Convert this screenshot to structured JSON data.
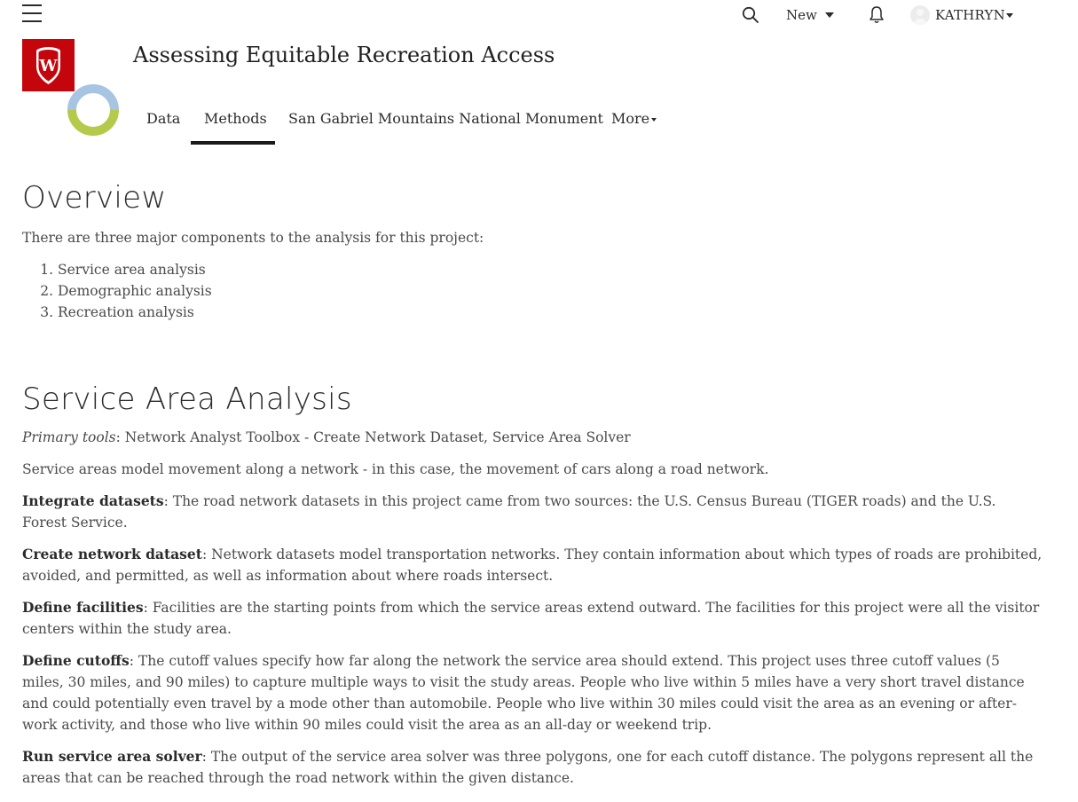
{
  "header": {
    "new_label": "New",
    "user_name": "KATHRYN",
    "icons": [
      "hamburger-menu-icon",
      "search-icon",
      "bell-icon"
    ]
  },
  "site": {
    "title": "Assessing Equitable Recreation Access",
    "logo_letter": "W",
    "colors": {
      "brand_red": "#c5050c",
      "ring_blue": "#a7c4e2",
      "ring_green": "#b5c94a"
    }
  },
  "nav": {
    "items": [
      "Data",
      "Methods",
      "San Gabriel Mountains National Monument",
      "More"
    ],
    "active": "Methods"
  },
  "overview": {
    "heading": "Overview",
    "intro": "There are three major components to the analysis for this project:",
    "list": [
      "Service area analysis",
      "Demographic analysis",
      "Recreation analysis"
    ]
  },
  "service_area": {
    "heading": "Service Area Analysis",
    "tools_label": "Primary tools",
    "tools_text": ": Network Analyst Toolbox - Create Network Dataset, Service Area Solver",
    "intro": "Service areas model movement along a network -  in this case, the movement of cars along a road network.",
    "steps": [
      {
        "term": "Integrate datasets",
        "text": ": The road network datasets in this project came from two sources: the U.S. Census Bureau (TIGER roads) and the U.S. Forest Service."
      },
      {
        "term": "Create network dataset",
        "text": ": Network datasets model transportation networks. They contain information about which types of roads are prohibited, avoided, and permitted, as well as information about where roads intersect."
      },
      {
        "term": "Define facilities",
        "text": ": Facilities are the starting points from which the service areas extend outward. The facilities for this project were all the visitor centers within the study area."
      },
      {
        "term": "Define cutoffs",
        "text": ": The cutoff values specify how far along the network the service area should extend. This project uses three cutoff values (5 miles, 30 miles, and 90 miles) to capture multiple ways to visit the study areas. People who live within 5 miles have a very short travel distance and could potentially even travel by a mode other than automobile. People who live within 30 miles could visit the area as an evening or after-work activity, and those who live within 90 miles could visit the area as an all-day or weekend trip."
      },
      {
        "term": "Run service area solver",
        "text": ": The output of the service area solver was three polygons, one for each cutoff distance. The polygons represent all the areas that can be reached through the road network within the given distance."
      }
    ]
  }
}
